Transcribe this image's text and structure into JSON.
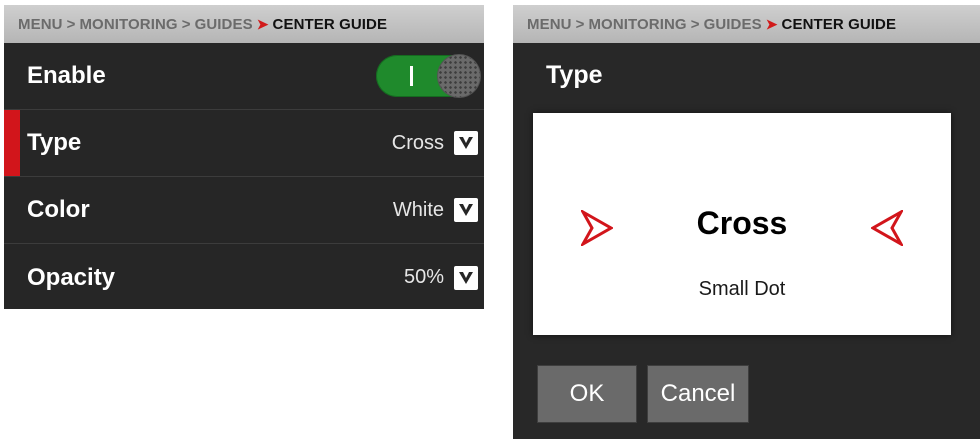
{
  "left": {
    "breadcrumb": {
      "items": [
        "MENU",
        "MONITORING",
        "GUIDES"
      ],
      "current": "CENTER GUIDE"
    },
    "rows": {
      "enable": {
        "label": "Enable",
        "state": "on"
      },
      "type": {
        "label": "Type",
        "value": "Cross"
      },
      "color": {
        "label": "Color",
        "value": "White"
      },
      "opacity": {
        "label": "Opacity",
        "value": "50%"
      }
    }
  },
  "right": {
    "breadcrumb": {
      "items": [
        "MENU",
        "MONITORING",
        "GUIDES"
      ],
      "current": "CENTER GUIDE"
    },
    "dialog": {
      "title": "Type",
      "current": "Cross",
      "next": "Small Dot",
      "ok_label": "OK",
      "cancel_label": "Cancel"
    }
  },
  "colors": {
    "accent_red": "#d2151b",
    "toggle_green": "#1f8a2c"
  }
}
